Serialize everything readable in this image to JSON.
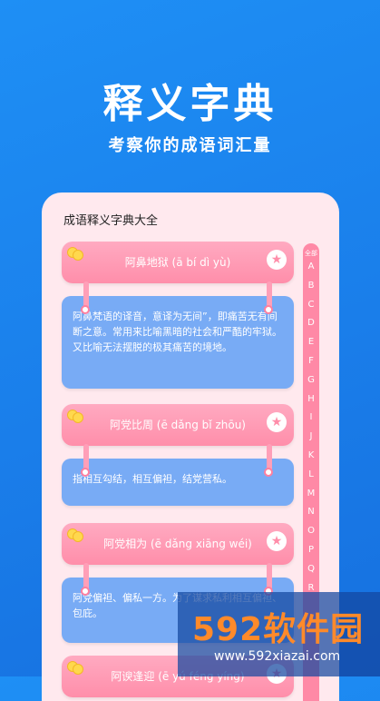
{
  "hero": {
    "title": "释义字典",
    "subtitle": "考察你的成语词汇量"
  },
  "phone": {
    "title": "成语释义字典大全"
  },
  "index": {
    "header": "全部",
    "letters": [
      "A",
      "B",
      "C",
      "D",
      "E",
      "F",
      "G",
      "H",
      "I",
      "J",
      "K",
      "L",
      "M",
      "N",
      "O",
      "P",
      "Q",
      "R"
    ]
  },
  "cards": [
    {
      "title": "阿鼻地狱 (ā bí dì yù)",
      "definition": "阿鼻梵语的译音，意译为无间”，即痛苦无有间断之意。常用来比喻黑暗的社会和严酷的牢狱。又比喻无法摆脱的极其痛苦的境地。"
    },
    {
      "title": "阿党比周 (ē dǎng bǐ zhōu)",
      "definition": "指相互勾结，相互偏袒，结党营私。"
    },
    {
      "title": "阿党相为 (ē dǎng xiāng wéi)",
      "definition": "阿党偏袒、偏私一方。为了谋求私利相互偏袒、包庇。"
    },
    {
      "title": "阿谀逢迎 (ē yú féng yíng)"
    }
  ],
  "watermark": {
    "brand": "592软件园",
    "url": "www.592xiazai.com"
  },
  "colors": {
    "background": "#1a7eea",
    "card_banner": "#ff8eaa",
    "card_body": "#78abf5",
    "panel": "#ffe9ee"
  }
}
